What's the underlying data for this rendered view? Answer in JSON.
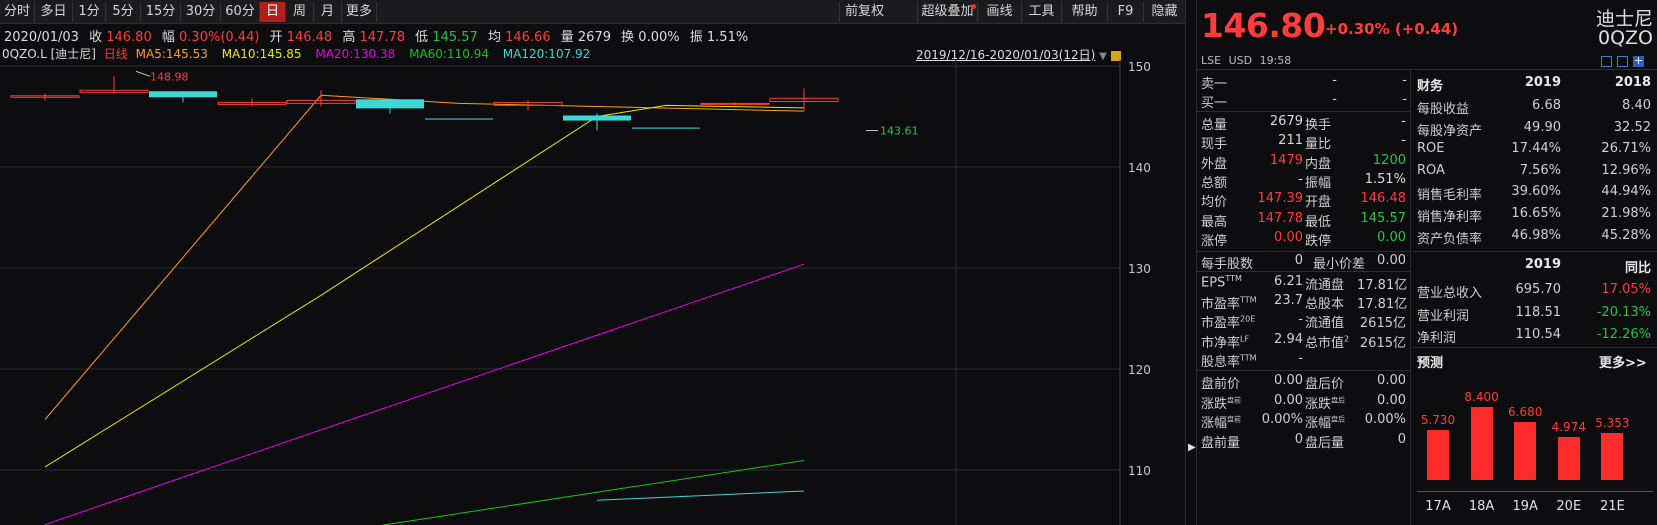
{
  "toolbar": {
    "left": [
      "分时",
      "多日",
      "1分",
      "5分",
      "15分",
      "30分",
      "60分",
      "日",
      "周",
      "月",
      "更多"
    ],
    "active": "日",
    "right": [
      "前复权",
      "超级叠加",
      "画线",
      "工具",
      "帮助",
      "F9",
      "隐藏"
    ]
  },
  "quote_line": {
    "date": "2020/01/03",
    "close_label": "收",
    "close": "146.80",
    "amp_label": "幅",
    "amp": "0.30%(0.44)",
    "open_label": "开",
    "open": "146.48",
    "high_label": "高",
    "high": "147.78",
    "low_label": "低",
    "low": "145.57",
    "avg_label": "均",
    "avg": "146.66",
    "vol_label": "量",
    "vol": "2679",
    "turn_label": "换",
    "turn": "0.00%",
    "swing_label": "振",
    "swing": "1.51%"
  },
  "ma_line": {
    "symbol": "0QZO.L [迪士尼]",
    "period": "日线",
    "ma5": "MA5:145.53",
    "ma10": "MA10:145.85",
    "ma20": "MA20:130.38",
    "ma60": "MA60:110.94",
    "ma120": "MA120:107.92",
    "range": "2019/12/16-2020/01/03(12日)"
  },
  "colors": {
    "up": "#ff3b3b",
    "down": "#27c24c",
    "ma5": "#ff9f1a",
    "ma10": "#e8e800",
    "ma20": "#e800e8",
    "ma60": "#19c219",
    "ma120": "#3fd6d6",
    "cyan_candle": "#3fd6d6"
  },
  "chart_data": {
    "type": "candlestick",
    "yticks": [
      150,
      140,
      130,
      120,
      110
    ],
    "ylim": [
      104.2,
      152.5
    ],
    "annotations": {
      "high": "148.98",
      "low": "143.61"
    },
    "candles": [
      {
        "open": 146.9,
        "close": 147.05,
        "high": 147.3,
        "low": 146.6
      },
      {
        "open": 147.4,
        "close": 147.6,
        "high": 148.98,
        "low": 147.2
      },
      {
        "open": 147.5,
        "close": 146.9,
        "high": 147.5,
        "low": 146.4
      },
      {
        "open": 146.2,
        "close": 146.4,
        "high": 146.8,
        "low": 146.0
      },
      {
        "open": 146.3,
        "close": 146.6,
        "high": 147.6,
        "low": 146.0
      },
      {
        "open": 146.7,
        "close": 145.8,
        "high": 146.8,
        "low": 145.3
      },
      {
        "open": 144.8,
        "close": 144.7,
        "high": 144.8,
        "low": 144.7
      },
      {
        "open": 146.1,
        "close": 146.4,
        "high": 146.6,
        "low": 145.6
      },
      {
        "open": 145.1,
        "close": 144.6,
        "high": 145.3,
        "low": 143.61
      },
      {
        "open": 143.9,
        "close": 143.8,
        "high": 143.9,
        "low": 143.8
      },
      {
        "open": 146.2,
        "close": 146.3,
        "high": 146.4,
        "low": 146.1
      },
      {
        "open": 146.48,
        "close": 146.8,
        "high": 147.78,
        "low": 145.57
      }
    ],
    "series": [
      {
        "name": "MA5",
        "values": [
          115.0,
          null,
          null,
          null,
          null,
          null,
          null,
          null,
          null,
          null,
          null,
          null,
          145.53
        ],
        "path": [
          [
            0,
            115.0
          ],
          [
            4,
            147.1
          ],
          [
            6,
            146.3
          ],
          [
            11,
            145.53
          ]
        ]
      },
      {
        "name": "MA10",
        "values": [],
        "path": [
          [
            0,
            110.3
          ],
          [
            4,
            127.3
          ],
          [
            8,
            145.0
          ],
          [
            9,
            146.1
          ],
          [
            11,
            145.85
          ]
        ]
      },
      {
        "name": "MA20",
        "values": [],
        "path": [
          [
            0,
            104.6
          ],
          [
            11,
            130.38
          ]
        ]
      },
      {
        "name": "MA60",
        "values": [],
        "path": [
          [
            4,
            103.6
          ],
          [
            11,
            110.94
          ]
        ]
      },
      {
        "name": "MA120",
        "values": [],
        "path": [
          [
            8,
            107.0
          ],
          [
            11,
            107.92
          ]
        ]
      }
    ]
  },
  "quote_panel": {
    "price": "146.80",
    "change": "+0.30% (+0.44)",
    "name": "迪士尼",
    "code": "0QZO",
    "exchange": "LSE",
    "currency": "USD",
    "time": "19:58"
  },
  "order_book": [
    {
      "label": "卖一",
      "price": "-",
      "vol": "-"
    },
    {
      "label": "买一",
      "price": "-",
      "vol": "-"
    }
  ],
  "stats": [
    [
      "总量",
      "2679",
      "换手",
      "-"
    ],
    [
      "现手",
      "211",
      "量比",
      "-"
    ],
    [
      "外盘",
      "1479",
      "内盘",
      "1200"
    ],
    [
      "总额",
      "-",
      "振幅",
      "1.51%"
    ],
    [
      "均价",
      "147.39",
      "开盘",
      "146.48"
    ],
    [
      "最高",
      "147.78",
      "最低",
      "145.57"
    ],
    [
      "涨停",
      "0.00",
      "跌停",
      "0.00"
    ]
  ],
  "stats2": [
    [
      "每手股数",
      "0",
      "最小价差",
      "0.00"
    ]
  ],
  "valuation": [
    [
      "EPS",
      "TTM",
      "6.21",
      "流通盘",
      "",
      "17.81亿"
    ],
    [
      "市盈率",
      "TTM",
      "23.7",
      "总股本",
      "",
      "17.81亿"
    ],
    [
      "市盈率",
      "20E",
      "-",
      "流通值",
      "",
      "2615亿"
    ],
    [
      "市净率",
      "LF",
      "2.94",
      "总市值",
      "2",
      "2615亿"
    ],
    [
      "股息率",
      "TTM",
      "-",
      "",
      "",
      ""
    ]
  ],
  "premarket": [
    [
      "盘前价",
      "",
      "0.00",
      "盘后价",
      "",
      "0.00"
    ],
    [
      "涨跌",
      "盘前",
      "0.00",
      "涨跌",
      "盘后",
      "0.00"
    ],
    [
      "涨幅",
      "盘前",
      "0.00%",
      "涨幅",
      "盘后",
      "0.00%"
    ],
    [
      "盘前量",
      "",
      "0",
      "盘后量",
      "",
      "0"
    ]
  ],
  "finance": {
    "header": [
      "财务",
      "2019",
      "2018"
    ],
    "rows": [
      [
        "每股收益",
        "6.68",
        "8.40"
      ],
      [
        "每股净资产",
        "49.90",
        "32.52"
      ],
      [
        "ROE",
        "17.44%",
        "26.71%"
      ],
      [
        "ROA",
        "7.56%",
        "12.96%"
      ],
      [
        "销售毛利率",
        "39.60%",
        "44.94%"
      ],
      [
        "销售净利率",
        "16.65%",
        "21.98%"
      ],
      [
        "资产负债率",
        "46.98%",
        "45.28%"
      ]
    ],
    "header2": [
      "",
      "2019",
      "同比"
    ],
    "rows2": [
      [
        "营业总收入",
        "695.70",
        "17.05%"
      ],
      [
        "营业利润",
        "118.51",
        "-20.13%"
      ],
      [
        "净利润",
        "110.54",
        "-12.26%"
      ]
    ]
  },
  "forecast": {
    "title": "预测",
    "more": "更多>>",
    "categories": [
      "17A",
      "18A",
      "19A",
      "20E",
      "21E"
    ],
    "values": [
      5.73,
      8.4,
      6.68,
      4.974,
      5.353
    ],
    "labels": [
      "5.730",
      "8.400",
      "6.680",
      "4.974",
      "5.353"
    ]
  }
}
